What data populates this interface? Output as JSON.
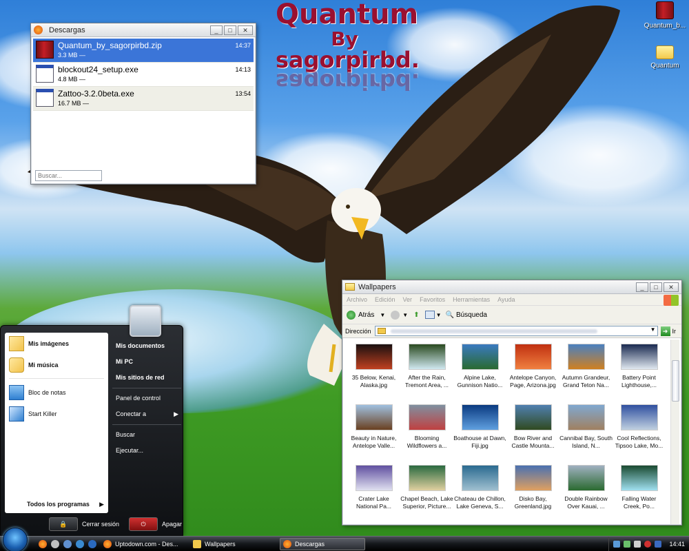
{
  "wallpaper": {
    "brand_line1": "Quantum",
    "brand_line2": "By",
    "brand_line3": "sagorpirbd.",
    "brand_color": "#9a1030"
  },
  "desktop_icons": [
    {
      "label": "Quantum_b...",
      "icon": "book-icon"
    },
    {
      "label": "Quantum",
      "icon": "folder-icon"
    }
  ],
  "downloads": {
    "title": "Descargas",
    "items": [
      {
        "name": "Quantum_by_sagorpirbd.zip",
        "size": "3.3 MB —",
        "time": "14:37"
      },
      {
        "name": "blockout24_setup.exe",
        "size": "4.8 MB —",
        "time": "14:13"
      },
      {
        "name": "Zattoo-3.2.0beta.exe",
        "size": "16.7 MB —",
        "time": "13:54"
      }
    ],
    "search_placeholder": "Buscar..."
  },
  "explorer": {
    "title": "Wallpapers",
    "menu": [
      "Archivo",
      "Edición",
      "Ver",
      "Favoritos",
      "Herramientas",
      "Ayuda"
    ],
    "back_label": "Atrás",
    "search_label": "Búsqueda",
    "address_label": "Dirección",
    "go_label": "Ir",
    "thumbnails": [
      {
        "caption": "35 Below, Kenai, Alaska.jpg",
        "c1": "#1a1010",
        "c2": "#c04020"
      },
      {
        "caption": "After the Rain, Tremont Area, ...",
        "c1": "#2a4a20",
        "c2": "#d0e8f0"
      },
      {
        "caption": "Alpine Lake, Gunnison Natio...",
        "c1": "#3a7ac0",
        "c2": "#2a6a30"
      },
      {
        "caption": "Antelope Canyon, Page, Arizona.jpg",
        "c1": "#c03010",
        "c2": "#f08040"
      },
      {
        "caption": "Autumn Grandeur, Grand Teton Na...",
        "c1": "#4a80c0",
        "c2": "#d08020"
      },
      {
        "caption": "Battery Point Lighthouse,...",
        "c1": "#1a2a50",
        "c2": "#e0e8f0"
      },
      {
        "caption": "Beauty in Nature, Antelope Valle...",
        "c1": "#a0c0e0",
        "c2": "#6a4020"
      },
      {
        "caption": "Blooming Wildflowers a...",
        "c1": "#8090a0",
        "c2": "#c04040"
      },
      {
        "caption": "Boathouse at Dawn, Fiji.jpg",
        "c1": "#0a3a80",
        "c2": "#60a0e0"
      },
      {
        "caption": "Bow River and Castle Mounta...",
        "c1": "#5080b0",
        "c2": "#304a20"
      },
      {
        "caption": "Cannibal Bay, South Island, N...",
        "c1": "#80a8d0",
        "c2": "#a08060"
      },
      {
        "caption": "Cool Reflections, Tipsoo Lake, Mo...",
        "c1": "#3050a0",
        "c2": "#c0d0e0"
      },
      {
        "caption": "Crater Lake National Pa...",
        "c1": "#6050a0",
        "c2": "#e0e0f0"
      },
      {
        "caption": "Chapel Beach, Lake Superior, Picture...",
        "c1": "#2a6a40",
        "c2": "#e0d0a0"
      },
      {
        "caption": "Chateau de Chillon, Lake Geneva, S...",
        "c1": "#2a6a90",
        "c2": "#a0c0d0"
      },
      {
        "caption": "Disko Bay, Greenland.jpg",
        "c1": "#4a70b0",
        "c2": "#e0a060"
      },
      {
        "caption": "Double Rainbow Over Kauai, ...",
        "c1": "#a0b0c0",
        "c2": "#2a6a30"
      },
      {
        "caption": "Falling Water Creek, Po...",
        "c1": "#1a4a30",
        "c2": "#a0e0f0"
      }
    ]
  },
  "start_menu": {
    "left_top": [
      {
        "label": "Mis imágenes",
        "icon": "pictures-folder-icon"
      },
      {
        "label": "Mi música",
        "icon": "music-folder-icon"
      }
    ],
    "left_programs": [
      {
        "label": "Bloc de notas",
        "icon": "notepad-icon"
      },
      {
        "label": "Start Killer",
        "icon": "start-killer-icon"
      }
    ],
    "all_programs": "Todos los programas",
    "right_bold": [
      "Mis documentos",
      "Mi PC",
      "Mis sitios de red"
    ],
    "right_mid": [
      "Panel de control",
      "Conectar a"
    ],
    "right_bottom": [
      "Buscar",
      "Ejecutar..."
    ],
    "logoff": "Cerrar sesión",
    "shutdown": "Apagar"
  },
  "taskbar": {
    "tasks": [
      {
        "label": "Uptodown.com - Des..."
      },
      {
        "label": "Wallpapers"
      },
      {
        "label": "Descargas"
      }
    ],
    "clock": "14:41"
  }
}
